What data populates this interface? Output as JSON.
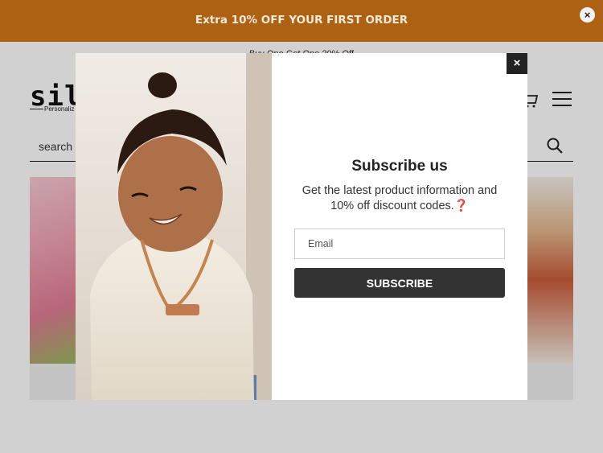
{
  "announcement": {
    "text": "Extra 10% OFF YOUR FIRST ORDER",
    "close_icon": "×",
    "background": "#ad6113"
  },
  "promo_strip": {
    "text": "Buy One Get One 20% Off"
  },
  "header": {
    "logo_text": "silv",
    "logo_tagline": "Personaliz",
    "cart_icon": "cart-icon",
    "menu_icon": "hamburger-icon",
    "search": {
      "placeholder": "search",
      "icon": "search-icon"
    }
  },
  "modal": {
    "title": "Subscribe us",
    "subtitle": "Get the latest product information and 10% off discount codes.❓",
    "email_placeholder": "Email",
    "subscribe_label": "SUBSCRIBE",
    "close_icon": "×",
    "button_color": "#333333"
  }
}
